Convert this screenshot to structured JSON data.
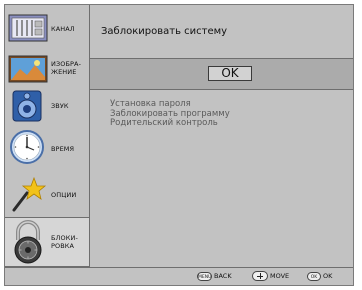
{
  "sidebar": {
    "items": [
      {
        "label": "КАНАЛ",
        "icon": "tv-channel-icon",
        "active": false
      },
      {
        "label": "ИЗОБРА-\nЖЕНИЕ",
        "icon": "picture-icon",
        "active": false
      },
      {
        "label": "ЗВУК",
        "icon": "speaker-icon",
        "active": false
      },
      {
        "label": "ВРЕМЯ",
        "icon": "clock-icon",
        "active": false
      },
      {
        "label": "ОПЦИИ",
        "icon": "star-wand-icon",
        "active": false
      },
      {
        "label": "БЛОКИ-\nРОВКА",
        "icon": "padlock-icon",
        "active": true
      }
    ]
  },
  "main": {
    "title": "Заблокировать систему",
    "ok_label": "OK",
    "menu_items": [
      "Установка пароля",
      "Заблокировать программу",
      "Родительский контроль"
    ]
  },
  "footer": {
    "back_key": "MENU",
    "back_label": "BACK",
    "move_label": "MOVE",
    "ok_key": "OK",
    "ok_label": "OK"
  },
  "colors": {
    "panel": "#c2c2c2",
    "ok_band": "#ababab",
    "active_item": "#d6d6d6",
    "border": "#6e6e6e"
  }
}
